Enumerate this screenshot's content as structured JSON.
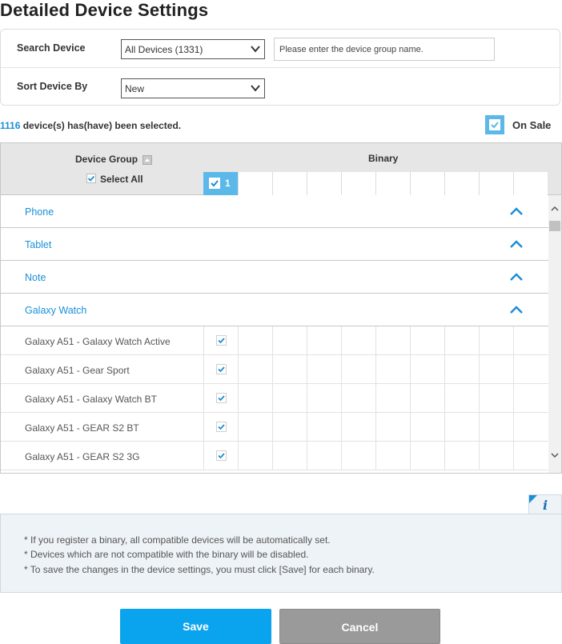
{
  "page": {
    "title": "Detailed Device Settings"
  },
  "search": {
    "search_label": "Search Device",
    "device_select_value": "All Devices (1331)",
    "group_input_placeholder": "Please enter the device group name.",
    "sort_label": "Sort Device By",
    "sort_select_value": "New"
  },
  "selection": {
    "count": "1116",
    "suffix": " device(s) has(have) been selected."
  },
  "on_sale": {
    "label": "On Sale",
    "checked": true
  },
  "grid": {
    "device_group_header": "Device Group",
    "select_all_label": "Select All",
    "binary_header": "Binary",
    "binaries": [
      {
        "label": "1",
        "checked": true
      }
    ],
    "groups": [
      {
        "label": "Phone",
        "expanded": true
      },
      {
        "label": "Tablet",
        "expanded": true
      },
      {
        "label": "Note",
        "expanded": true
      },
      {
        "label": "Galaxy Watch",
        "expanded": true
      }
    ],
    "devices": [
      {
        "name": "Galaxy A51 - Galaxy Watch Active",
        "checked": true
      },
      {
        "name": "Galaxy A51 - Gear Sport",
        "checked": true
      },
      {
        "name": "Galaxy A51 - Galaxy Watch BT",
        "checked": true
      },
      {
        "name": "Galaxy A51 - GEAR S2 BT",
        "checked": true
      },
      {
        "name": "Galaxy A51 - GEAR S2 3G",
        "checked": true
      }
    ]
  },
  "info": {
    "lines": [
      "* If you register a binary, all compatible devices will be automatically set.",
      "* Devices which are not compatible with the binary will be disabled.",
      "* To save the changes in the device settings, you must click [Save] for each binary."
    ]
  },
  "buttons": {
    "save": "Save",
    "cancel": "Cancel"
  },
  "colors": {
    "accent": "#0aa4ee",
    "link": "#1a8fd8",
    "checkbox": "#5bb8e8",
    "cancel": "#9a9a9a"
  }
}
